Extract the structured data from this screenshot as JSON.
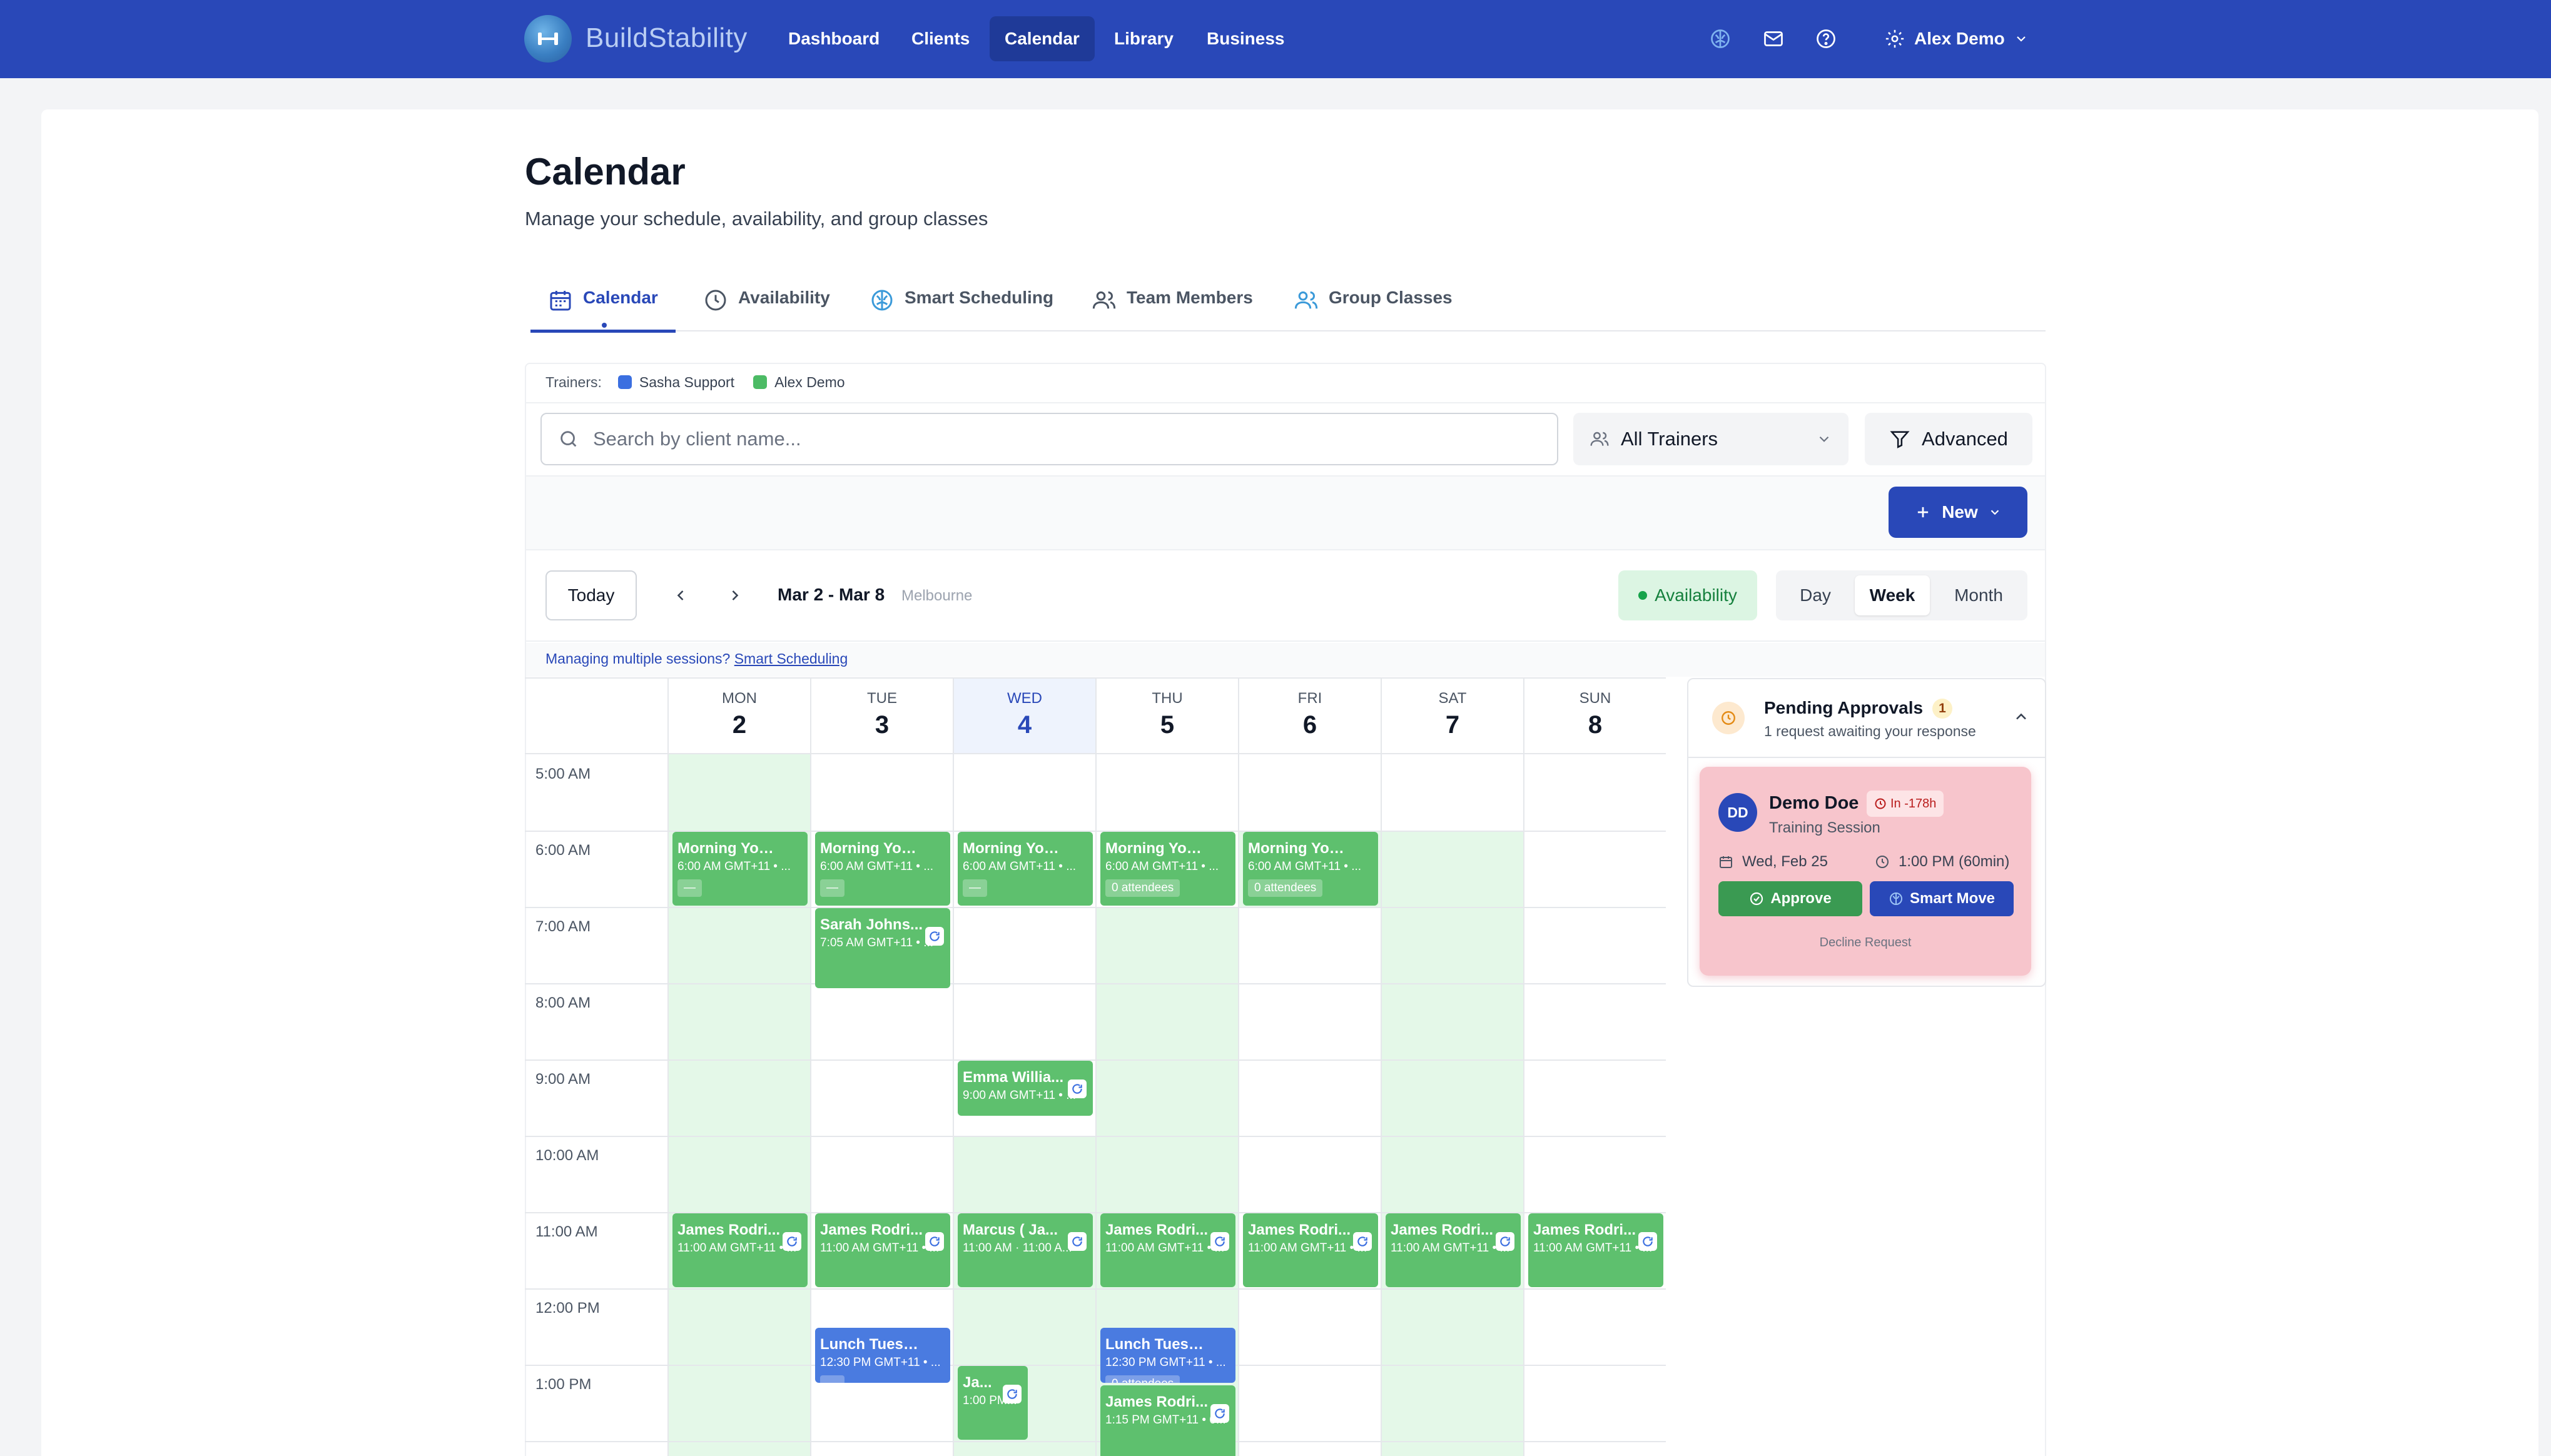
{
  "app": {
    "brand": "BuildStability",
    "nav": [
      "Dashboard",
      "Clients",
      "Calendar",
      "Library",
      "Business"
    ],
    "active_nav": "Calendar",
    "user_name": "Alex Demo"
  },
  "page": {
    "title": "Calendar",
    "subtitle": "Manage your schedule, availability, and group classes"
  },
  "tabs": [
    {
      "label": "Calendar",
      "icon": "calendar-icon",
      "active": true
    },
    {
      "label": "Availability",
      "icon": "clock-icon",
      "active": false
    },
    {
      "label": "Smart Scheduling",
      "icon": "brain-icon",
      "active": false
    },
    {
      "label": "Team Members",
      "icon": "users-icon",
      "active": false
    },
    {
      "label": "Group Classes",
      "icon": "group-icon",
      "active": false
    }
  ],
  "filters": {
    "trainers_label": "Trainers:",
    "trainers": [
      {
        "name": "Sasha Support",
        "color": "#3b6fe0"
      },
      {
        "name": "Alex Demo",
        "color": "#4cbb65"
      }
    ],
    "search_placeholder": "Search by client name...",
    "trainer_select": "All Trainers",
    "advanced_label": "Advanced",
    "new_label": "New"
  },
  "toolbar": {
    "today_label": "Today",
    "date_range": "Mar 2 - Mar 8",
    "timezone": "Melbourne",
    "availability_label": "Availability",
    "views": [
      "Day",
      "Week",
      "Month"
    ],
    "active_view": "Week",
    "hint_text": "Managing multiple sessions?",
    "hint_link": "Smart Scheduling"
  },
  "calendar": {
    "days": [
      {
        "name": "MON",
        "num": "2"
      },
      {
        "name": "TUE",
        "num": "3"
      },
      {
        "name": "WED",
        "num": "4",
        "today": true
      },
      {
        "name": "THU",
        "num": "5"
      },
      {
        "name": "FRI",
        "num": "6"
      },
      {
        "name": "SAT",
        "num": "7"
      },
      {
        "name": "SUN",
        "num": "8"
      }
    ],
    "hours": [
      "5:00 AM",
      "6:00 AM",
      "7:00 AM",
      "8:00 AM",
      "9:00 AM",
      "10:00 AM",
      "11:00 AM",
      "12:00 PM",
      "1:00 PM"
    ],
    "events": [
      {
        "day": 0,
        "start": 6.0,
        "end": 7.0,
        "title": "Morning Yoga 6 ...",
        "time": "6:00 AM  GMT+11 • ...",
        "chip": "—",
        "color": "green"
      },
      {
        "day": 1,
        "start": 6.0,
        "end": 7.0,
        "title": "Morning Yoga 6 ...",
        "time": "6:00 AM  GMT+11 • ...",
        "chip": "—",
        "color": "green"
      },
      {
        "day": 2,
        "start": 6.0,
        "end": 7.0,
        "title": "Morning Yoga 6 ...",
        "time": "6:00 AM  GMT+11 • ...",
        "chip": "—",
        "color": "green"
      },
      {
        "day": 3,
        "start": 6.0,
        "end": 7.0,
        "title": "Morning Yoga 6 ...",
        "time": "6:00 AM  GMT+11 • ...",
        "chip": "0 attendees",
        "color": "green"
      },
      {
        "day": 4,
        "start": 6.0,
        "end": 7.0,
        "title": "Morning Yoga 6 ...",
        "time": "6:00 AM  GMT+11 • ...",
        "chip": "0 attendees",
        "color": "green"
      },
      {
        "day": 1,
        "start": 7.0,
        "end": 8.08,
        "title": "Sarah Johns...",
        "time": "7:05 AM  GMT+11 • ...",
        "repeat": true,
        "color": "green"
      },
      {
        "day": 2,
        "start": 9.0,
        "end": 9.75,
        "title": "Emma Willia...",
        "time": "9:00 AM  GMT+11 • ...",
        "repeat": true,
        "color": "green"
      },
      {
        "day": 0,
        "start": 11.0,
        "end": 12.0,
        "title": "James Rodri...",
        "time": "11:00 AM  GMT+11 • ...",
        "repeat": true,
        "color": "green"
      },
      {
        "day": 1,
        "start": 11.0,
        "end": 12.0,
        "title": "James Rodri...",
        "time": "11:00 AM  GMT+11 • ...",
        "repeat": true,
        "color": "green"
      },
      {
        "day": 2,
        "start": 11.0,
        "end": 12.0,
        "title": "Marcus ( Ja...",
        "time": "11:00 AM · 11:00 A...",
        "repeat": true,
        "color": "green"
      },
      {
        "day": 3,
        "start": 11.0,
        "end": 12.0,
        "title": "James Rodri...",
        "time": "11:00 AM  GMT+11 • ...",
        "repeat": true,
        "color": "green"
      },
      {
        "day": 4,
        "start": 11.0,
        "end": 12.0,
        "title": "James Rodri...",
        "time": "11:00 AM  GMT+11 • ...",
        "repeat": true,
        "color": "green"
      },
      {
        "day": 5,
        "start": 11.0,
        "end": 12.0,
        "title": "James Rodri...",
        "time": "11:00 AM  GMT+11 • ...",
        "repeat": true,
        "color": "green"
      },
      {
        "day": 6,
        "start": 11.0,
        "end": 12.0,
        "title": "James Rodri...",
        "time": "11:00 AM  GMT+11 • ...",
        "repeat": true,
        "color": "green"
      },
      {
        "day": 1,
        "start": 12.5,
        "end": 13.25,
        "title": "Lunch Tuesday ...",
        "time": "12:30 PM  GMT+11 • ...",
        "chip": "—",
        "color": "blue"
      },
      {
        "day": 3,
        "start": 12.5,
        "end": 13.25,
        "title": "Lunch Tuesday ...",
        "time": "12:30 PM  GMT+11 • ...",
        "chip": "0 attendees",
        "color": "blue"
      },
      {
        "day": 2,
        "start": 13.0,
        "end": 14.0,
        "title": "Ja...",
        "time": "1:00 PM...",
        "repeat": true,
        "color": "green",
        "narrow": true
      },
      {
        "day": 3,
        "start": 13.25,
        "end": 14.25,
        "title": "James Rodri...",
        "time": "1:15 PM  GMT+11 • 6...",
        "repeat": true,
        "color": "green"
      }
    ],
    "availability": [
      {
        "day": 0,
        "start": 5.0,
        "end": 14.5
      },
      {
        "day": 2,
        "start": 10.0,
        "end": 14.5
      },
      {
        "day": 3,
        "start": 7.0,
        "end": 14.5
      },
      {
        "day": 4,
        "start": 6.0,
        "end": 7.0
      },
      {
        "day": 5,
        "start": 6.0,
        "end": 14.5
      }
    ]
  },
  "approvals": {
    "title": "Pending Approvals",
    "count": "1",
    "subtitle": "1 request awaiting your response",
    "request": {
      "initials": "DD",
      "name": "Demo Doe",
      "badge": "In -178h",
      "type": "Training Session",
      "date": "Wed, Feb 25",
      "time": "1:00 PM (60min)",
      "approve_label": "Approve",
      "smart_move_label": "Smart Move",
      "decline_label": "Decline Request"
    }
  }
}
